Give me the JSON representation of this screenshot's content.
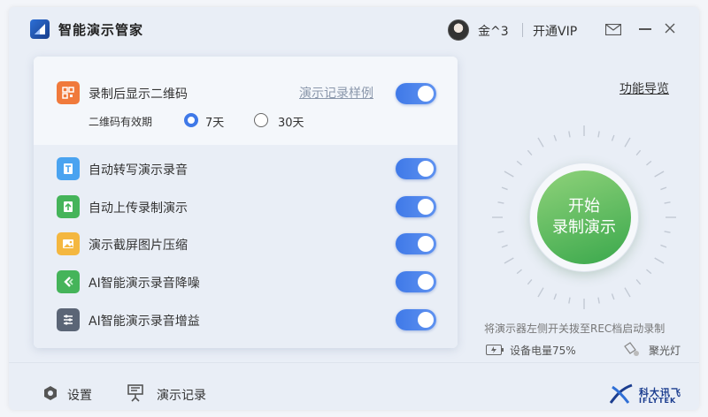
{
  "header": {
    "app_title": "智能演示管家",
    "username": "金^3",
    "vip_label": "开通VIP"
  },
  "panel": {
    "qr_row": {
      "label": "录制后显示二维码",
      "link": "演示记录样例",
      "sub_label": "二维码有效期",
      "options": [
        "7天",
        "30天"
      ],
      "selected": "7天",
      "enabled": true
    },
    "rows": [
      {
        "label": "自动转写演示录音",
        "icon": "transcribe-icon",
        "enabled": true
      },
      {
        "label": "自动上传录制演示",
        "icon": "upload-icon",
        "enabled": true
      },
      {
        "label": "演示截屏图片压缩",
        "icon": "image-compress-icon",
        "enabled": true
      },
      {
        "label": "AI智能演示录音降噪",
        "icon": "noise-reduction-icon",
        "enabled": true
      },
      {
        "label": "AI智能演示录音增益",
        "icon": "gain-icon",
        "enabled": true
      }
    ]
  },
  "right": {
    "guide_link": "功能导览",
    "start_line1": "开始",
    "start_line2": "录制演示",
    "hint": "将演示器左侧开关拨至REC档启动录制",
    "battery": "设备电量75%",
    "light": "聚光灯"
  },
  "footer": {
    "settings": "设置",
    "records": "演示记录",
    "brand_cn": "科大讯飞",
    "brand_en": "IFLYTEK"
  },
  "colors": {
    "accent": "#3f79e8",
    "start_green": "#4caf50",
    "qr_orange": "#f07a3c",
    "icon_blue": "#4aa3f0",
    "icon_green": "#45b45a",
    "icon_yellow": "#f4b740",
    "icon_gray": "#5b6576"
  }
}
